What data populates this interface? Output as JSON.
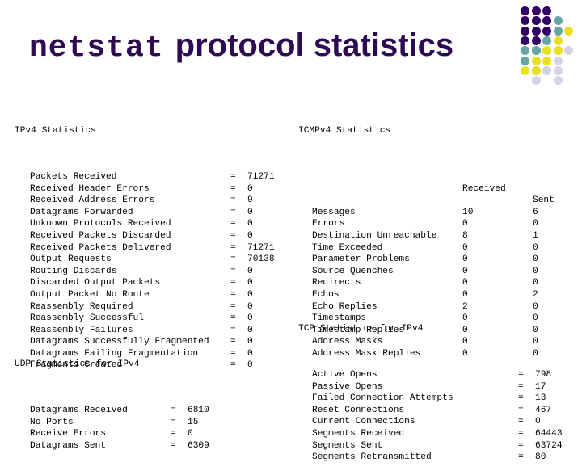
{
  "title": {
    "mono_part": "netstat",
    "sans_part": "protocol statistics",
    "color": "#2D0A52"
  },
  "decoration": {
    "divider_color": "#000000",
    "palette": {
      "purple": "#330066",
      "teal": "#66A5A5",
      "yellow": "#E8E020",
      "lavender": "#D3D3E8"
    },
    "dots": [
      {
        "r": 0,
        "c": 0,
        "color": "#330066"
      },
      {
        "r": 0,
        "c": 1,
        "color": "#330066"
      },
      {
        "r": 0,
        "c": 2,
        "color": "#330066"
      },
      {
        "r": 1,
        "c": 0,
        "color": "#330066"
      },
      {
        "r": 1,
        "c": 1,
        "color": "#330066"
      },
      {
        "r": 1,
        "c": 2,
        "color": "#330066"
      },
      {
        "r": 1,
        "c": 3,
        "color": "#66A5A5"
      },
      {
        "r": 2,
        "c": 0,
        "color": "#330066"
      },
      {
        "r": 2,
        "c": 1,
        "color": "#330066"
      },
      {
        "r": 2,
        "c": 2,
        "color": "#330066"
      },
      {
        "r": 2,
        "c": 3,
        "color": "#66A5A5"
      },
      {
        "r": 2,
        "c": 4,
        "color": "#E8E020"
      },
      {
        "r": 3,
        "c": 0,
        "color": "#330066"
      },
      {
        "r": 3,
        "c": 1,
        "color": "#330066"
      },
      {
        "r": 3,
        "c": 2,
        "color": "#66A5A5"
      },
      {
        "r": 3,
        "c": 3,
        "color": "#E8E020"
      },
      {
        "r": 4,
        "c": 0,
        "color": "#66A5A5"
      },
      {
        "r": 4,
        "c": 1,
        "color": "#66A5A5"
      },
      {
        "r": 4,
        "c": 2,
        "color": "#E8E020"
      },
      {
        "r": 4,
        "c": 3,
        "color": "#E8E020"
      },
      {
        "r": 4,
        "c": 4,
        "color": "#D3D3E8"
      },
      {
        "r": 5,
        "c": 0,
        "color": "#66A5A5"
      },
      {
        "r": 5,
        "c": 1,
        "color": "#E8E020"
      },
      {
        "r": 5,
        "c": 2,
        "color": "#E8E020"
      },
      {
        "r": 5,
        "c": 3,
        "color": "#D3D3E8"
      },
      {
        "r": 6,
        "c": 0,
        "color": "#E8E020"
      },
      {
        "r": 6,
        "c": 1,
        "color": "#E8E020"
      },
      {
        "r": 6,
        "c": 2,
        "color": "#D3D3E8"
      },
      {
        "r": 6,
        "c": 3,
        "color": "#D3D3E8"
      },
      {
        "r": 7,
        "c": 1,
        "color": "#D3D3E8"
      },
      {
        "r": 7,
        "c": 3,
        "color": "#D3D3E8"
      }
    ]
  },
  "ipv4": {
    "heading": "IPv4 Statistics",
    "eq": "=",
    "rows": [
      {
        "label": "Packets Received",
        "value": "71271"
      },
      {
        "label": "Received Header Errors",
        "value": "0"
      },
      {
        "label": "Received Address Errors",
        "value": "9"
      },
      {
        "label": "Datagrams Forwarded",
        "value": "0"
      },
      {
        "label": "Unknown Protocols Received",
        "value": "0"
      },
      {
        "label": "Received Packets Discarded",
        "value": "0"
      },
      {
        "label": "Received Packets Delivered",
        "value": "71271"
      },
      {
        "label": "Output Requests",
        "value": "70138"
      },
      {
        "label": "Routing Discards",
        "value": "0"
      },
      {
        "label": "Discarded Output Packets",
        "value": "0"
      },
      {
        "label": "Output Packet No Route",
        "value": "0"
      },
      {
        "label": "Reassembly Required",
        "value": "0"
      },
      {
        "label": "Reassembly Successful",
        "value": "0"
      },
      {
        "label": "Reassembly Failures",
        "value": "0"
      },
      {
        "label": "Datagrams Successfully Fragmented",
        "value": "0"
      },
      {
        "label": "Datagrams Failing Fragmentation",
        "value": "0"
      },
      {
        "label": "Fragments Created",
        "value": "0"
      }
    ]
  },
  "udp": {
    "heading": "UDP Statistics for IPv4",
    "eq": "=",
    "rows": [
      {
        "label": "Datagrams Received",
        "value": "6810"
      },
      {
        "label": "No Ports",
        "value": "15"
      },
      {
        "label": "Receive Errors",
        "value": "0"
      },
      {
        "label": "Datagrams Sent",
        "value": "6309"
      }
    ]
  },
  "icmp": {
    "heading": "ICMPv4 Statistics",
    "col_received": "Received",
    "col_sent": "Sent",
    "rows": [
      {
        "label": "Messages",
        "received": "10",
        "sent": "6"
      },
      {
        "label": "Errors",
        "received": "0",
        "sent": "0"
      },
      {
        "label": "Destination Unreachable",
        "received": "8",
        "sent": "1"
      },
      {
        "label": "Time Exceeded",
        "received": "0",
        "sent": "0"
      },
      {
        "label": "Parameter Problems",
        "received": "0",
        "sent": "0"
      },
      {
        "label": "Source Quenches",
        "received": "0",
        "sent": "0"
      },
      {
        "label": "Redirects",
        "received": "0",
        "sent": "0"
      },
      {
        "label": "Echos",
        "received": "0",
        "sent": "2"
      },
      {
        "label": "Echo Replies",
        "received": "2",
        "sent": "0"
      },
      {
        "label": "Timestamps",
        "received": "0",
        "sent": "0"
      },
      {
        "label": "Timestamp Replies",
        "received": "0",
        "sent": "0"
      },
      {
        "label": "Address Masks",
        "received": "0",
        "sent": "0"
      },
      {
        "label": "Address Mask Replies",
        "received": "0",
        "sent": "0"
      }
    ]
  },
  "tcp": {
    "heading": "TCP Statistics for IPv4",
    "eq": "=",
    "rows": [
      {
        "label": "Active Opens",
        "value": "798"
      },
      {
        "label": "Passive Opens",
        "value": "17"
      },
      {
        "label": "Failed Connection Attempts",
        "value": "13"
      },
      {
        "label": "Reset Connections",
        "value": "467"
      },
      {
        "label": "Current Connections",
        "value": "0"
      },
      {
        "label": "Segments Received",
        "value": "64443"
      },
      {
        "label": "Segments Sent",
        "value": "63724"
      },
      {
        "label": "Segments Retransmitted",
        "value": "80"
      }
    ]
  }
}
